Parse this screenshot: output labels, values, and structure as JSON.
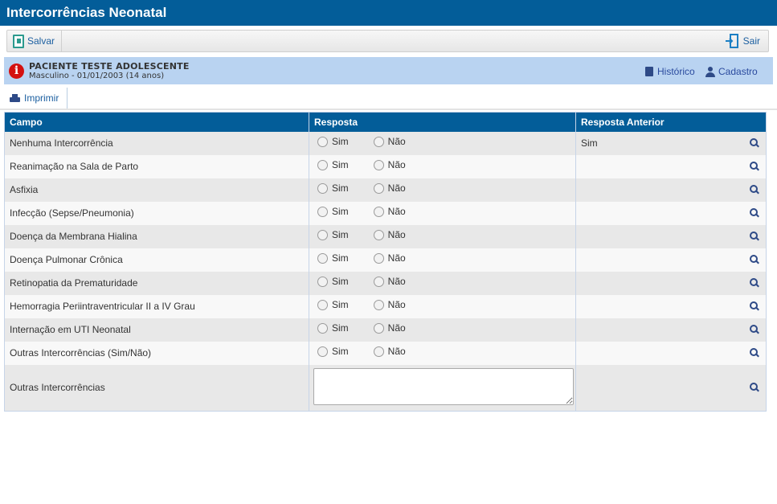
{
  "window": {
    "title": "Intercorrências Neonatal"
  },
  "toolbar": {
    "save_label": "Salvar",
    "exit_label": "Sair"
  },
  "patient": {
    "name": "PACIENTE TESTE ADOLESCENTE",
    "details": "Masculino - 01/01/2003 (14 anos)",
    "history_label": "Histórico",
    "register_label": "Cadastro"
  },
  "actions": {
    "print_label": "Imprimir"
  },
  "table": {
    "headers": [
      "Campo",
      "Resposta",
      "Resposta Anterior"
    ],
    "option_yes": "Sim",
    "option_no": "Não",
    "rows": [
      {
        "campo": "Nenhuma Intercorrência",
        "anterior": "Sim"
      },
      {
        "campo": "Reanimação na Sala de Parto",
        "anterior": ""
      },
      {
        "campo": "Asfixia",
        "anterior": ""
      },
      {
        "campo": "Infecção (Sepse/Pneumonia)",
        "anterior": ""
      },
      {
        "campo": "Doença da Membrana Hialina",
        "anterior": ""
      },
      {
        "campo": "Doença Pulmonar Crônica",
        "anterior": ""
      },
      {
        "campo": "Retinopatia da Prematuridade",
        "anterior": ""
      },
      {
        "campo": "Hemorragia Periintraventricular II a IV Grau",
        "anterior": ""
      },
      {
        "campo": "Internação em UTI Neonatal",
        "anterior": ""
      },
      {
        "campo": "Outras Intercorrências (Sim/Não)",
        "anterior": ""
      }
    ],
    "text_row": {
      "campo": "Outras Intercorrências",
      "value": "",
      "anterior": ""
    }
  },
  "colors": {
    "header_blue": "#035d99",
    "patient_bar": "#b9d3f1",
    "alert_red": "#d41010",
    "link_blue": "#1c5fa0"
  }
}
